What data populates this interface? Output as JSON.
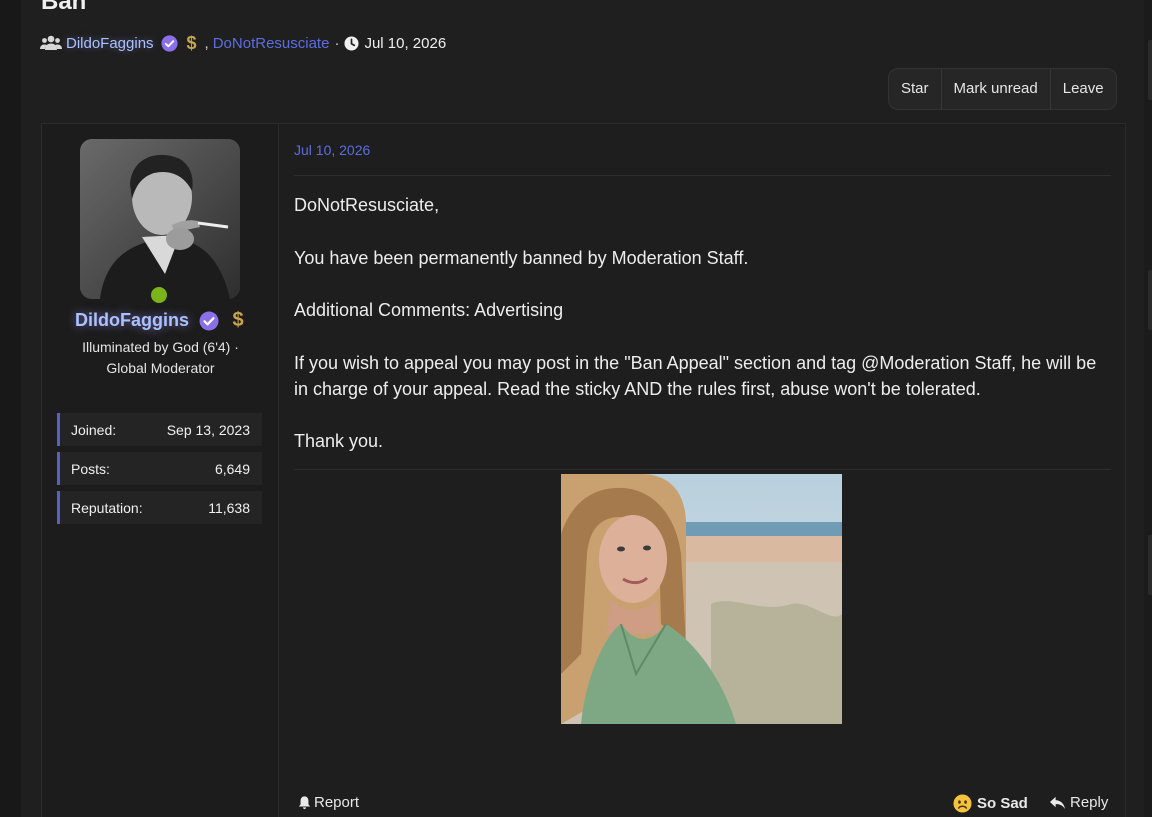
{
  "thread": {
    "title": "Ban",
    "participants": [
      "DildoFaggins",
      "DoNotResusciate"
    ],
    "separator": ",",
    "dot": "·",
    "date": "Jul 10, 2026"
  },
  "actions": {
    "star": "Star",
    "mark_unread": "Mark unread",
    "leave": "Leave"
  },
  "author": {
    "name": "DildoFaggins",
    "title_line1": "Illuminated by God (6'4) ·",
    "title_line2": "Global Moderator",
    "online_color": "#7bb31a",
    "name_color": "#a9c2ff",
    "badges": [
      "verified-check-icon",
      "dollar-sign-icon"
    ]
  },
  "stats": [
    {
      "label": "Joined:",
      "value": "Sep 13, 2023"
    },
    {
      "label": "Posts:",
      "value": "6,649"
    },
    {
      "label": "Reputation:",
      "value": "11,638"
    }
  ],
  "message": {
    "date": "Jul 10, 2026",
    "paragraphs": [
      "DoNotResusciate,",
      "You have been permanently banned by Moderation Staff.",
      "Additional Comments: Advertising",
      "If you wish to appeal you may post in the \"Ban Appeal\" section and tag @Moderation Staff, he will be in charge of your appeal. Read the sticky AND the rules first, abuse won't be tolerated.",
      "Thank you."
    ]
  },
  "footer": {
    "report": "Report",
    "reaction": "So Sad",
    "reply": "Reply"
  },
  "colors": {
    "accent": "#5b6ee0",
    "background": "#1f1f1f",
    "panel": "#1c1c1c",
    "stat_border": "#5560c8"
  }
}
